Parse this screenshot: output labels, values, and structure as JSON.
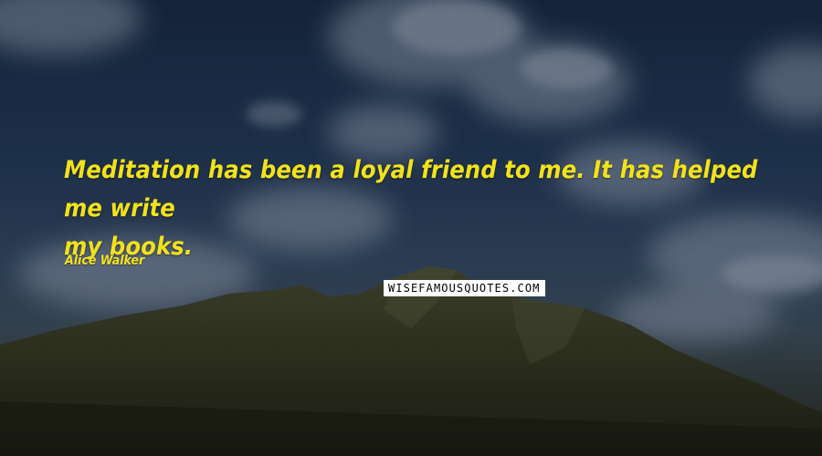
{
  "quote": {
    "line1": "Meditation has been a loyal friend to me. It has helped me write",
    "line2": "my books."
  },
  "author": "Alice Walker",
  "watermark": "WISEFAMOUSQUOTES.COM",
  "colors": {
    "quote_text": "#f2e21c",
    "sky": "#1d3049",
    "mountain": "#2a2d1c"
  }
}
